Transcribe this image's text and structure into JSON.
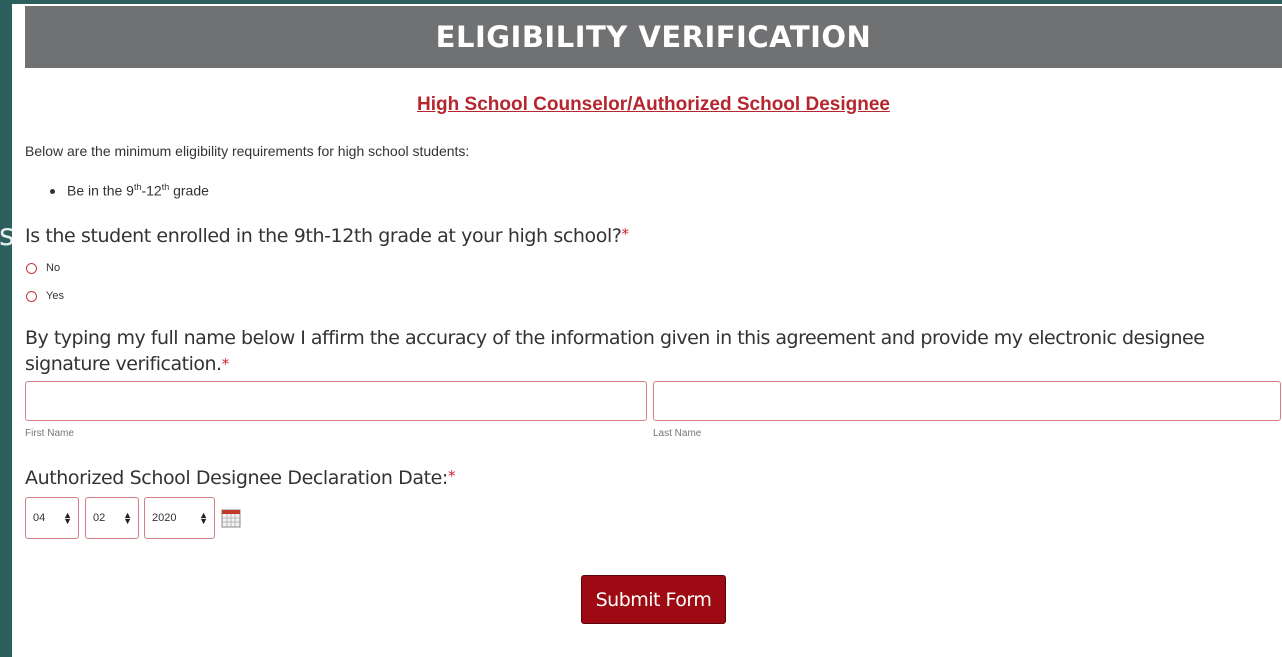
{
  "background_letter": "s",
  "header": {
    "title": "ELIGIBILITY VERIFICATION"
  },
  "subtitle": "High School Counselor/Authorized School Designee",
  "intro": "Below are the minimum eligibility requirements for high school students:",
  "requirements": [
    {
      "prefix": "Be in the 9",
      "sup1": "th",
      "middle": "-12",
      "sup2": "th",
      "suffix": " grade"
    }
  ],
  "question": {
    "text": "Is the student enrolled in the 9th-12th grade at your high school?",
    "required_mark": "*"
  },
  "options": [
    {
      "label": "No"
    },
    {
      "label": "Yes"
    }
  ],
  "affirmation": {
    "text": "By typing my full name below I affirm the accuracy of the information given in this agreement and provide my electronic designee signature verification.",
    "required_mark": "*"
  },
  "first_name": {
    "label": "First Name",
    "value": ""
  },
  "last_name": {
    "label": "Last Name",
    "value": ""
  },
  "date": {
    "label": "Authorized School Designee Declaration Date:",
    "required_mark": "*",
    "month": "04",
    "day": "02",
    "year": "2020",
    "calendar_icon": "calendar-icon"
  },
  "submit_label": "Submit Form",
  "colors": {
    "header_bg": "#707173",
    "accent": "#b5262e",
    "submit_bg": "#9e0a14",
    "page_bg": "#2e5f5f"
  }
}
